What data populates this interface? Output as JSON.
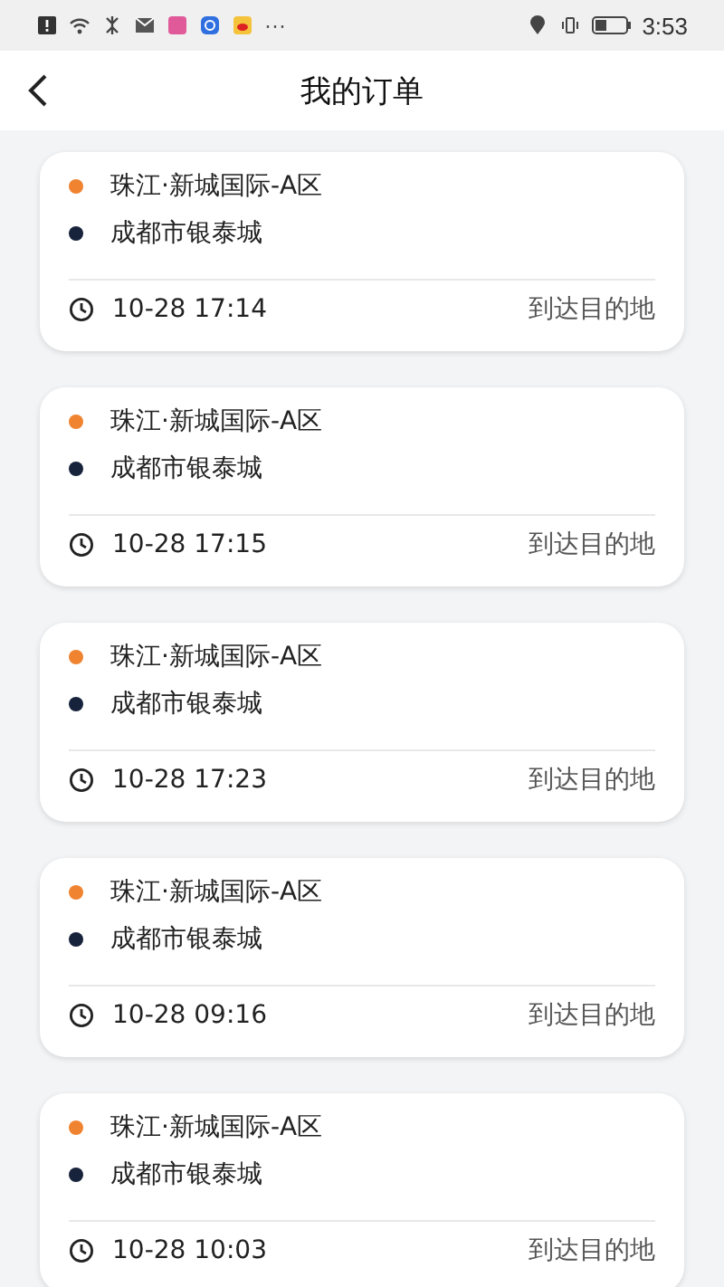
{
  "status_bar": {
    "more": "···",
    "time": "3:53"
  },
  "header": {
    "title": "我的订单"
  },
  "orders": [
    {
      "stops": [
        {
          "name": "珠江·新城国际-A区",
          "color": "#f0832f"
        },
        {
          "name": "成都市银泰城",
          "color": "#17223b"
        }
      ],
      "time": "10-28 17:14",
      "status": "到达目的地"
    },
    {
      "stops": [
        {
          "name": "珠江·新城国际-A区",
          "color": "#f0832f"
        },
        {
          "name": "成都市银泰城",
          "color": "#17223b"
        }
      ],
      "time": "10-28 17:15",
      "status": "到达目的地"
    },
    {
      "stops": [
        {
          "name": "珠江·新城国际-A区",
          "color": "#f0832f"
        },
        {
          "name": "成都市银泰城",
          "color": "#17223b"
        }
      ],
      "time": "10-28 17:23",
      "status": "到达目的地"
    },
    {
      "stops": [
        {
          "name": "珠江·新城国际-A区",
          "color": "#f0832f"
        },
        {
          "name": "成都市银泰城",
          "color": "#17223b"
        }
      ],
      "time": "10-28 09:16",
      "status": "到达目的地"
    },
    {
      "stops": [
        {
          "name": "珠江·新城国际-A区",
          "color": "#f0832f"
        },
        {
          "name": "成都市银泰城",
          "color": "#17223b"
        }
      ],
      "time": "10-28 10:03",
      "status": "到达目的地"
    }
  ]
}
